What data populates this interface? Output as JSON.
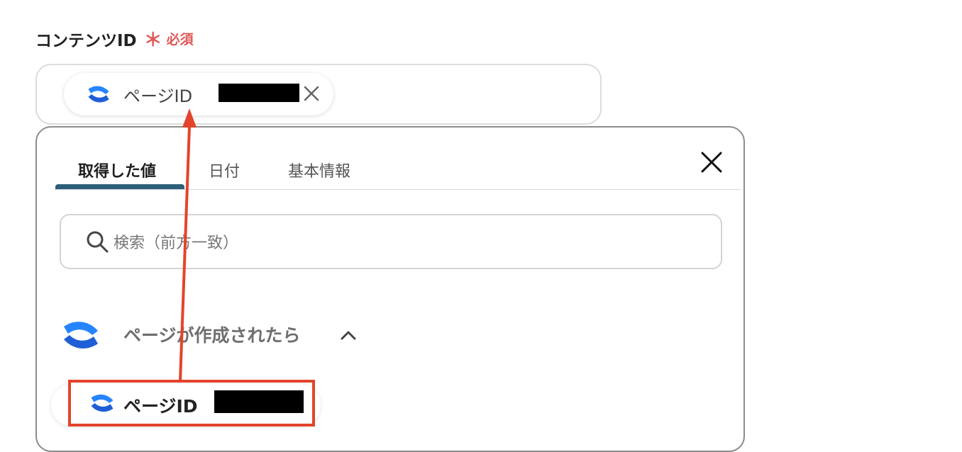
{
  "field": {
    "label": "コンテンツID",
    "required_mark": "＊",
    "required_text": "必須"
  },
  "chip": {
    "icon": "confluence-icon",
    "label": "ページID",
    "close_icon": "close-icon"
  },
  "dropdown": {
    "tabs": [
      {
        "label": "取得した値",
        "active": true
      },
      {
        "label": "日付",
        "active": false
      },
      {
        "label": "基本情報",
        "active": false
      }
    ],
    "close_icon": "close-icon",
    "search": {
      "placeholder": "検索（前方一致）",
      "icon": "search-icon"
    },
    "group": {
      "icon": "confluence-icon",
      "label": "ページが作成されたら",
      "toggle_icon": "chevron-up-icon",
      "items": [
        {
          "label": "ページID",
          "icon": "confluence-icon"
        }
      ]
    }
  },
  "colors": {
    "required": "#e05a5a",
    "tab_underline": "#2d5e78",
    "annotation": "#e3442b",
    "confluence_blue": "#2684ff"
  }
}
